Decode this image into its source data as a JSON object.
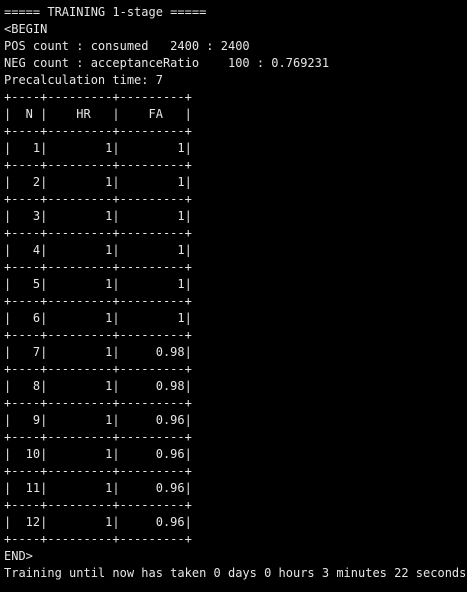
{
  "terminal": {
    "lines": [
      "===== TRAINING 1-stage =====",
      "<BEGIN",
      "POS count : consumed   2400 : 2400",
      "NEG count : acceptanceRatio    100 : 0.769231",
      "Precalculation time: 7",
      "+----+---------+---------+",
      "|  N |    HR   |    FA   |",
      "+----+---------+---------+",
      "|   1|        1|        1|",
      "+----+---------+---------+",
      "|   2|        1|        1|",
      "+----+---------+---------+",
      "|   3|        1|        1|",
      "+----+---------+---------+",
      "|   4|        1|        1|",
      "+----+---------+---------+",
      "|   5|        1|        1|",
      "+----+---------+---------+",
      "|   6|        1|        1|",
      "+----+---------+---------+",
      "|   7|        1|     0.98|",
      "+----+---------+---------+",
      "|   8|        1|     0.98|",
      "+----+---------+---------+",
      "|   9|        1|     0.96|",
      "+----+---------+---------+",
      "|  10|        1|     0.96|",
      "+----+---------+---------+",
      "|  11|        1|     0.96|",
      "+----+---------+---------+",
      "|  12|        1|     0.96|",
      "+----+---------+---------+",
      "END>",
      "Training until now has taken 0 days 0 hours 3 minutes 22 seconds."
    ]
  },
  "colors": {
    "background": "#000000",
    "text": "#e6e6e6"
  }
}
